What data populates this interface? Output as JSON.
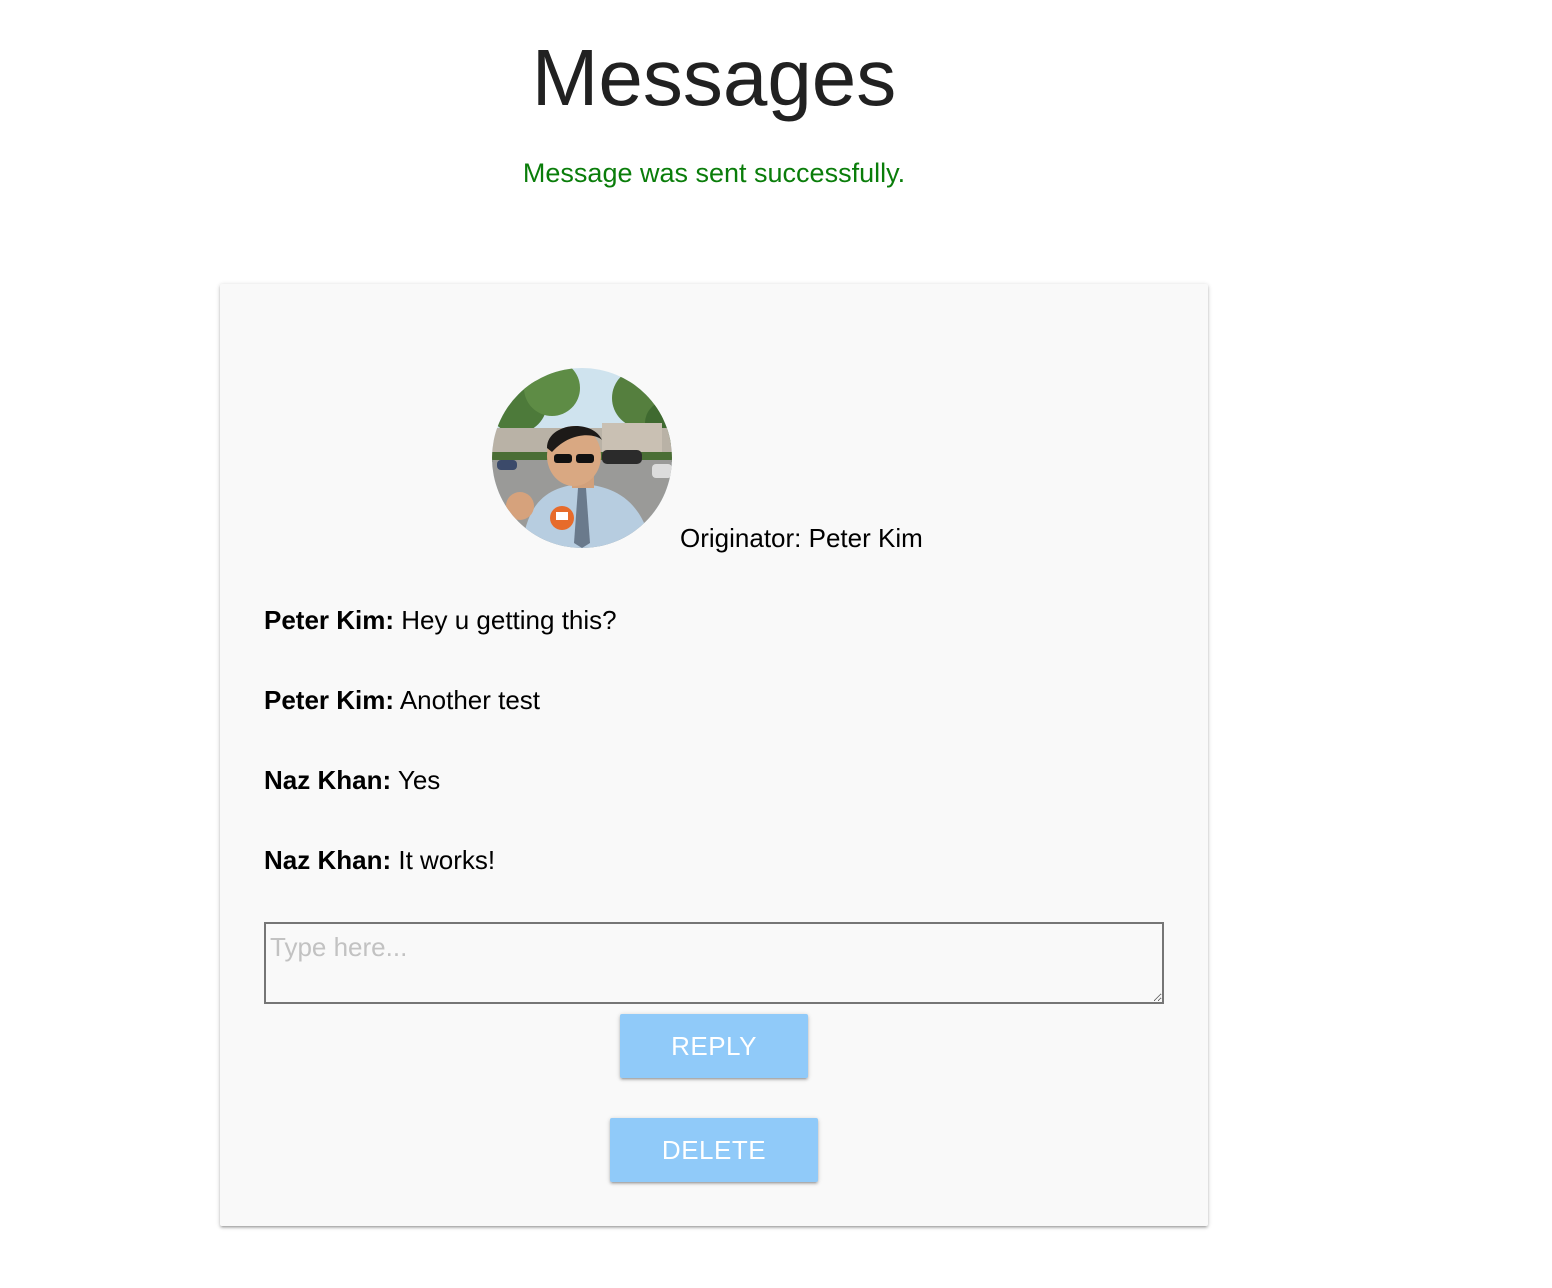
{
  "page": {
    "title": "Messages",
    "flash_message": "Message was sent successfully.",
    "flash_color": "#0a7d0a"
  },
  "thread": {
    "avatar_icon": "user-photo",
    "originator_label": "Originator: Peter Kim",
    "messages": [
      {
        "sender": "Peter Kim:",
        "text": " Hey u getting this?"
      },
      {
        "sender": "Peter Kim:",
        "text": " Another test"
      },
      {
        "sender": "Naz Khan:",
        "text": " Yes"
      },
      {
        "sender": "Naz Khan:",
        "text": " It works!"
      }
    ]
  },
  "reply": {
    "placeholder": "Type here...",
    "value": ""
  },
  "actions": {
    "reply_label": "Reply",
    "delete_label": "Delete",
    "button_color": "#90caf9"
  }
}
